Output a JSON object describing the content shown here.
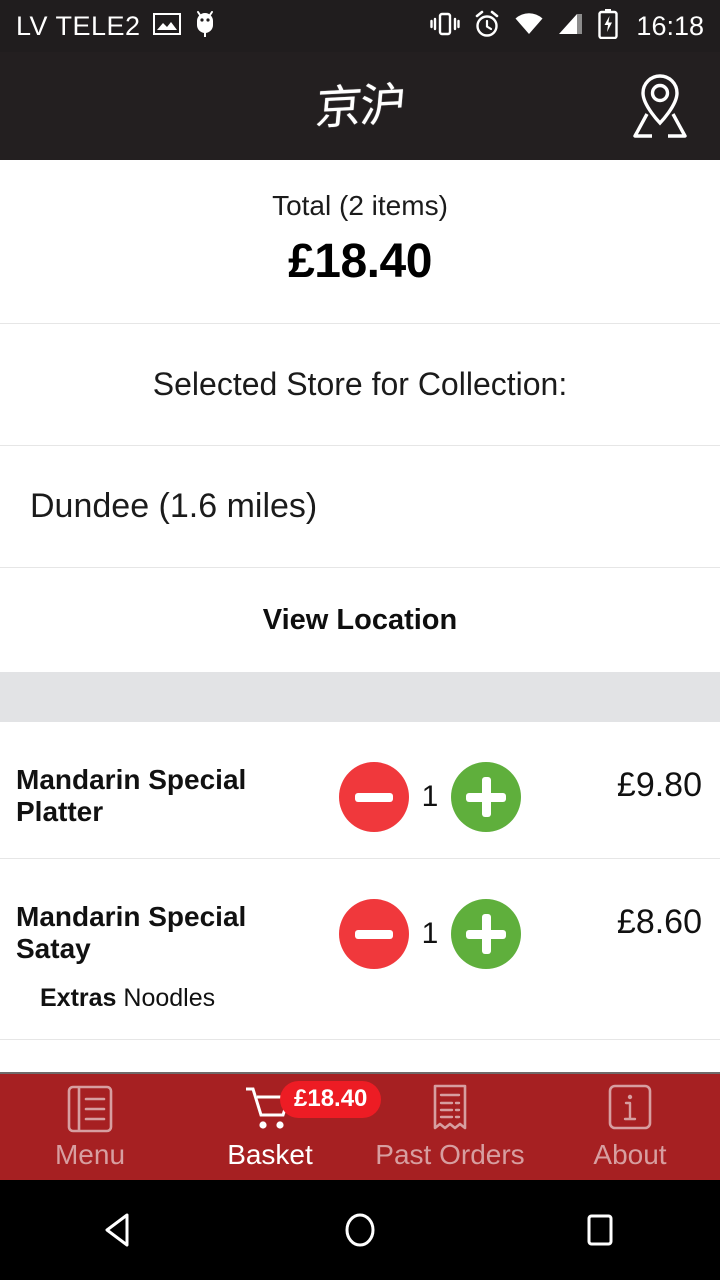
{
  "status_bar": {
    "carrier": "LV TELE2",
    "time": "16:18",
    "icons": [
      "image-icon",
      "android-bug-icon",
      "vibrate-icon",
      "alarm-icon",
      "wifi-icon",
      "signal-icon",
      "battery-charging-icon"
    ]
  },
  "header": {
    "logo_text": "京沪",
    "location_icon": "map-pin-icon"
  },
  "summary": {
    "total_label": "Total (2 items)",
    "total_amount": "£18.40"
  },
  "store": {
    "heading": "Selected Store for Collection:",
    "name": "Dundee (1.6 miles)",
    "view_location_label": "View Location"
  },
  "cart": {
    "items": [
      {
        "name": "Mandarin Special Platter",
        "quantity": "1",
        "price": "£9.80",
        "extras_label": "",
        "extras_value": ""
      },
      {
        "name": "Mandarin Special Satay",
        "quantity": "1",
        "price": "£8.60",
        "extras_label": "Extras",
        "extras_value": "Noodles"
      }
    ]
  },
  "tabs": [
    {
      "label": "Menu",
      "icon": "menu-book-icon",
      "active": false,
      "badge": ""
    },
    {
      "label": "Basket",
      "icon": "shopping-cart-icon",
      "active": true,
      "badge": "£18.40"
    },
    {
      "label": "Past Orders",
      "icon": "receipt-icon",
      "active": false,
      "badge": ""
    },
    {
      "label": "About",
      "icon": "info-icon",
      "active": false,
      "badge": ""
    }
  ],
  "android_nav": {
    "back": "back-triangle-icon",
    "home": "home-circle-icon",
    "recents": "recents-square-icon"
  },
  "colors": {
    "header_bg": "#231f20",
    "tabbar_bg": "#a62022",
    "badge_bg": "#ed1c24",
    "minus_button": "#f0383c",
    "plus_button": "#5faf3c",
    "gray_band": "#e2e3e5"
  }
}
